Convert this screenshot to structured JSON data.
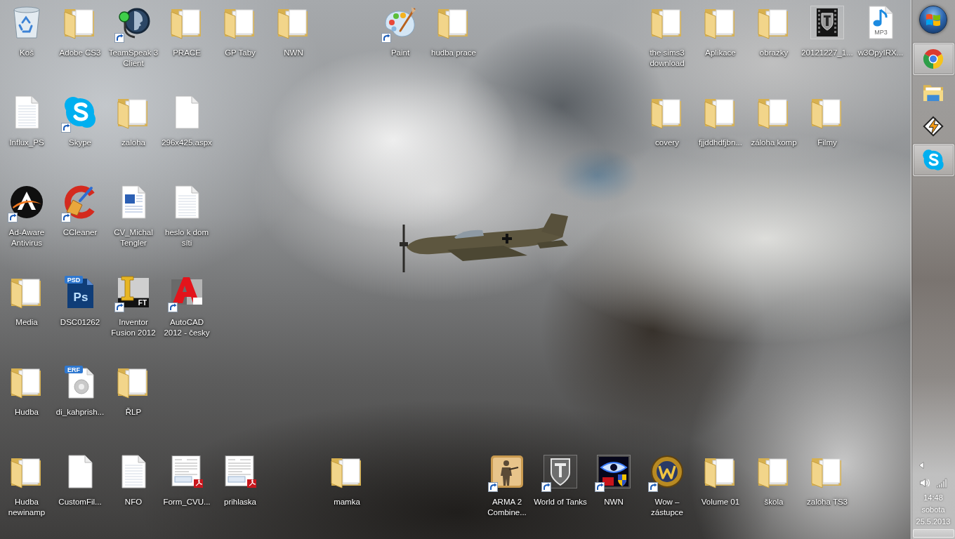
{
  "desktop_icons": [
    {
      "label": "Koš",
      "kind": "recycle-bin",
      "shortcut": false
    },
    {
      "label": "Adobe CS3",
      "kind": "folder",
      "shortcut": false
    },
    {
      "label": "TeamSpeak 3 Client",
      "kind": "teamspeak",
      "shortcut": true
    },
    {
      "label": "PRACE",
      "kind": "folder",
      "shortcut": false
    },
    {
      "label": "GP Taby",
      "kind": "folder",
      "shortcut": false
    },
    {
      "label": "NWN",
      "kind": "folder",
      "shortcut": false
    },
    {
      "label": "Paint",
      "kind": "paint",
      "shortcut": true
    },
    {
      "label": "hudba prace",
      "kind": "folder",
      "shortcut": false
    },
    {
      "label": "the sims3 download",
      "kind": "folder",
      "shortcut": false
    },
    {
      "label": "Aplikace",
      "kind": "folder",
      "shortcut": false
    },
    {
      "label": "obrazky",
      "kind": "folder",
      "shortcut": false
    },
    {
      "label": "20121227_1...",
      "kind": "video",
      "shortcut": false
    },
    {
      "label": "w3OpyIRX...",
      "kind": "mp3",
      "shortcut": false,
      "badge": "MP3"
    },
    {
      "label": "Influx_PS",
      "kind": "text-file",
      "shortcut": false
    },
    {
      "label": "Skype",
      "kind": "skype",
      "shortcut": true
    },
    {
      "label": "zaloha",
      "kind": "folder",
      "shortcut": false
    },
    {
      "label": "296x425.aspx",
      "kind": "file",
      "shortcut": false
    },
    {
      "label": "covery",
      "kind": "folder",
      "shortcut": false
    },
    {
      "label": "fjjddhdfjbn...",
      "kind": "folder",
      "shortcut": false
    },
    {
      "label": "záloha komp",
      "kind": "folder",
      "shortcut": false
    },
    {
      "label": "Filmy",
      "kind": "folder",
      "shortcut": false
    },
    {
      "label": "Ad-Aware Antivirus",
      "kind": "adaware",
      "shortcut": true
    },
    {
      "label": "CCleaner",
      "kind": "ccleaner",
      "shortcut": true
    },
    {
      "label": "CV_Michal Tengler",
      "kind": "word",
      "shortcut": false
    },
    {
      "label": "heslo k dom síti",
      "kind": "text-file",
      "shortcut": false
    },
    {
      "label": "Media",
      "kind": "folder",
      "shortcut": false
    },
    {
      "label": "DSC01262",
      "kind": "psd",
      "shortcut": false,
      "badge": "PSD",
      "mark": "Ps"
    },
    {
      "label": "Inventor Fusion 2012",
      "kind": "inventor",
      "shortcut": true,
      "badge": "FT"
    },
    {
      "label": "AutoCAD 2012 - česky",
      "kind": "autocad",
      "shortcut": true
    },
    {
      "label": "Hudba",
      "kind": "folder",
      "shortcut": false
    },
    {
      "label": "di_kahprish...",
      "kind": "erf",
      "shortcut": false,
      "badge": "ERF"
    },
    {
      "label": "ŘLP",
      "kind": "folder",
      "shortcut": false
    },
    {
      "label": "Hudba newinamp",
      "kind": "folder",
      "shortcut": false
    },
    {
      "label": "CustomFil...",
      "kind": "file",
      "shortcut": false
    },
    {
      "label": "NFO",
      "kind": "text-file",
      "shortcut": false
    },
    {
      "label": "Form_CVU...",
      "kind": "pdf",
      "shortcut": false
    },
    {
      "label": "prihlaska",
      "kind": "pdf",
      "shortcut": false
    },
    {
      "label": "mamka",
      "kind": "folder",
      "shortcut": false
    },
    {
      "label": "ARMA 2 Combine...",
      "kind": "game",
      "shortcut": true
    },
    {
      "label": "World of Tanks",
      "kind": "tank-game",
      "shortcut": true
    },
    {
      "label": "NWN",
      "kind": "eye-game",
      "shortcut": true
    },
    {
      "label": "Wow – zástupce",
      "kind": "wow",
      "shortcut": true
    },
    {
      "label": "Volume 01",
      "kind": "folder",
      "shortcut": false
    },
    {
      "label": "škola",
      "kind": "folder",
      "shortcut": false
    },
    {
      "label": "zaloha TS3",
      "kind": "folder",
      "shortcut": false
    }
  ],
  "taskbar": {
    "buttons": [
      {
        "kind": "browser",
        "running": true
      },
      {
        "kind": "explorer",
        "running": false
      },
      {
        "kind": "media-player",
        "running": false
      },
      {
        "kind": "skype",
        "running": true
      }
    ],
    "clock": {
      "time": "14:48",
      "day": "sobota",
      "date": "25.5.2013"
    }
  }
}
